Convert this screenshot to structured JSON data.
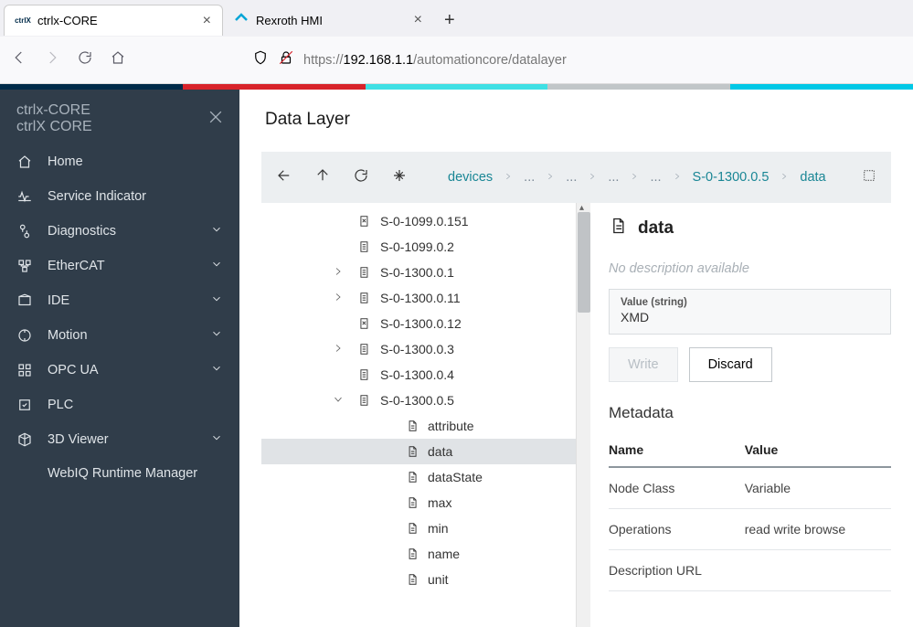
{
  "browser": {
    "tabs": [
      {
        "favicon": "ctrlX",
        "title": "ctrlx-CORE",
        "active": true
      },
      {
        "favicon": "rex",
        "title": "Rexroth HMI",
        "active": false
      }
    ],
    "url_prefix": "https://",
    "url_host": "192.168.1.1",
    "url_path": "/automationcore/datalayer"
  },
  "sidebar": {
    "title1": "ctrlx-CORE",
    "title2": "ctrlX CORE",
    "items": [
      {
        "icon": "home",
        "label": "Home",
        "expandable": false
      },
      {
        "icon": "service",
        "label": "Service Indicator",
        "expandable": false
      },
      {
        "icon": "diag",
        "label": "Diagnostics",
        "expandable": true
      },
      {
        "icon": "ecat",
        "label": "EtherCAT",
        "expandable": true
      },
      {
        "icon": "ide",
        "label": "IDE",
        "expandable": true
      },
      {
        "icon": "motion",
        "label": "Motion",
        "expandable": true
      },
      {
        "icon": "opcua",
        "label": "OPC UA",
        "expandable": true
      },
      {
        "icon": "plc",
        "label": "PLC",
        "expandable": false
      },
      {
        "icon": "viewer",
        "label": "3D Viewer",
        "expandable": true
      },
      {
        "icon": "none",
        "label": "WebIQ Runtime Manager",
        "expandable": false,
        "sub": true
      }
    ]
  },
  "page": {
    "title": "Data Layer"
  },
  "breadcrumb": {
    "items": [
      "devices",
      "...",
      "...",
      "...",
      "...",
      "S-0-1300.0.5",
      "data"
    ]
  },
  "tree": {
    "nodes": [
      {
        "label": "S-0-1099.0.151",
        "icon": "leaf-x"
      },
      {
        "label": "S-0-1099.0.2",
        "icon": "leaf"
      },
      {
        "label": "S-0-1300.0.1",
        "icon": "leaf",
        "arrow": "right"
      },
      {
        "label": "S-0-1300.0.11",
        "icon": "leaf",
        "arrow": "right"
      },
      {
        "label": "S-0-1300.0.12",
        "icon": "leaf-x"
      },
      {
        "label": "S-0-1300.0.3",
        "icon": "leaf",
        "arrow": "right"
      },
      {
        "label": "S-0-1300.0.4",
        "icon": "leaf"
      },
      {
        "label": "S-0-1300.0.5",
        "icon": "leaf",
        "arrow": "down"
      },
      {
        "label": "attribute",
        "icon": "page",
        "child": true
      },
      {
        "label": "data",
        "icon": "page",
        "child": true,
        "selected": true
      },
      {
        "label": "dataState",
        "icon": "page",
        "child": true
      },
      {
        "label": "max",
        "icon": "page",
        "child": true
      },
      {
        "label": "min",
        "icon": "page",
        "child": true
      },
      {
        "label": "name",
        "icon": "page",
        "child": true
      },
      {
        "label": "unit",
        "icon": "page",
        "child": true
      }
    ]
  },
  "detail": {
    "title": "data",
    "description": "No description available",
    "value_label": "Value (string)",
    "value": "XMD",
    "write_label": "Write",
    "discard_label": "Discard",
    "metadata_title": "Metadata",
    "table": {
      "headers": [
        "Name",
        "Value"
      ],
      "rows": [
        {
          "name": "Node Class",
          "value": "Variable"
        },
        {
          "name": "Operations",
          "value": "read  write  browse"
        },
        {
          "name": "Description URL",
          "value": ""
        }
      ]
    }
  }
}
